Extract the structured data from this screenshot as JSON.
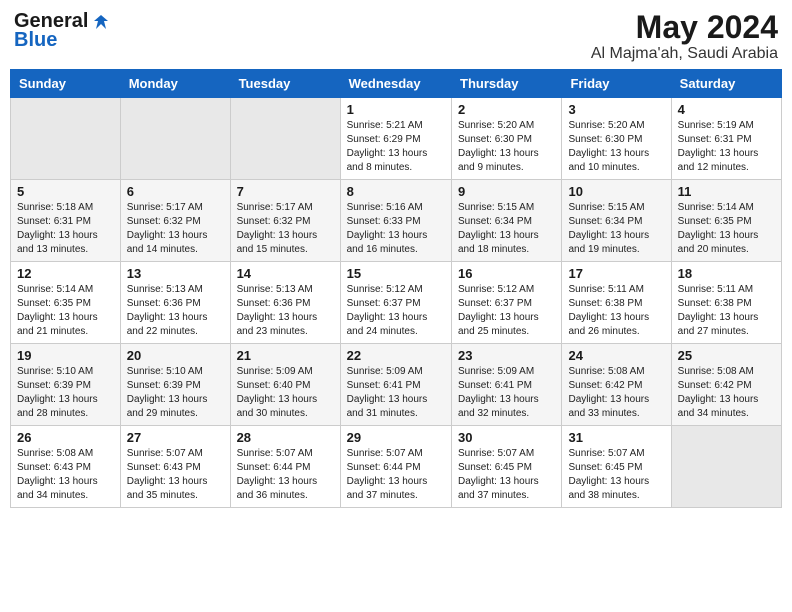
{
  "logo": {
    "line1": "General",
    "line2": "Blue"
  },
  "title": "May 2024",
  "subtitle": "Al Majma'ah, Saudi Arabia",
  "header": {
    "days": [
      "Sunday",
      "Monday",
      "Tuesday",
      "Wednesday",
      "Thursday",
      "Friday",
      "Saturday"
    ]
  },
  "weeks": [
    [
      {
        "day": "",
        "info": ""
      },
      {
        "day": "",
        "info": ""
      },
      {
        "day": "",
        "info": ""
      },
      {
        "day": "1",
        "info": "Sunrise: 5:21 AM\nSunset: 6:29 PM\nDaylight: 13 hours\nand 8 minutes."
      },
      {
        "day": "2",
        "info": "Sunrise: 5:20 AM\nSunset: 6:30 PM\nDaylight: 13 hours\nand 9 minutes."
      },
      {
        "day": "3",
        "info": "Sunrise: 5:20 AM\nSunset: 6:30 PM\nDaylight: 13 hours\nand 10 minutes."
      },
      {
        "day": "4",
        "info": "Sunrise: 5:19 AM\nSunset: 6:31 PM\nDaylight: 13 hours\nand 12 minutes."
      }
    ],
    [
      {
        "day": "5",
        "info": "Sunrise: 5:18 AM\nSunset: 6:31 PM\nDaylight: 13 hours\nand 13 minutes."
      },
      {
        "day": "6",
        "info": "Sunrise: 5:17 AM\nSunset: 6:32 PM\nDaylight: 13 hours\nand 14 minutes."
      },
      {
        "day": "7",
        "info": "Sunrise: 5:17 AM\nSunset: 6:32 PM\nDaylight: 13 hours\nand 15 minutes."
      },
      {
        "day": "8",
        "info": "Sunrise: 5:16 AM\nSunset: 6:33 PM\nDaylight: 13 hours\nand 16 minutes."
      },
      {
        "day": "9",
        "info": "Sunrise: 5:15 AM\nSunset: 6:34 PM\nDaylight: 13 hours\nand 18 minutes."
      },
      {
        "day": "10",
        "info": "Sunrise: 5:15 AM\nSunset: 6:34 PM\nDaylight: 13 hours\nand 19 minutes."
      },
      {
        "day": "11",
        "info": "Sunrise: 5:14 AM\nSunset: 6:35 PM\nDaylight: 13 hours\nand 20 minutes."
      }
    ],
    [
      {
        "day": "12",
        "info": "Sunrise: 5:14 AM\nSunset: 6:35 PM\nDaylight: 13 hours\nand 21 minutes."
      },
      {
        "day": "13",
        "info": "Sunrise: 5:13 AM\nSunset: 6:36 PM\nDaylight: 13 hours\nand 22 minutes."
      },
      {
        "day": "14",
        "info": "Sunrise: 5:13 AM\nSunset: 6:36 PM\nDaylight: 13 hours\nand 23 minutes."
      },
      {
        "day": "15",
        "info": "Sunrise: 5:12 AM\nSunset: 6:37 PM\nDaylight: 13 hours\nand 24 minutes."
      },
      {
        "day": "16",
        "info": "Sunrise: 5:12 AM\nSunset: 6:37 PM\nDaylight: 13 hours\nand 25 minutes."
      },
      {
        "day": "17",
        "info": "Sunrise: 5:11 AM\nSunset: 6:38 PM\nDaylight: 13 hours\nand 26 minutes."
      },
      {
        "day": "18",
        "info": "Sunrise: 5:11 AM\nSunset: 6:38 PM\nDaylight: 13 hours\nand 27 minutes."
      }
    ],
    [
      {
        "day": "19",
        "info": "Sunrise: 5:10 AM\nSunset: 6:39 PM\nDaylight: 13 hours\nand 28 minutes."
      },
      {
        "day": "20",
        "info": "Sunrise: 5:10 AM\nSunset: 6:39 PM\nDaylight: 13 hours\nand 29 minutes."
      },
      {
        "day": "21",
        "info": "Sunrise: 5:09 AM\nSunset: 6:40 PM\nDaylight: 13 hours\nand 30 minutes."
      },
      {
        "day": "22",
        "info": "Sunrise: 5:09 AM\nSunset: 6:41 PM\nDaylight: 13 hours\nand 31 minutes."
      },
      {
        "day": "23",
        "info": "Sunrise: 5:09 AM\nSunset: 6:41 PM\nDaylight: 13 hours\nand 32 minutes."
      },
      {
        "day": "24",
        "info": "Sunrise: 5:08 AM\nSunset: 6:42 PM\nDaylight: 13 hours\nand 33 minutes."
      },
      {
        "day": "25",
        "info": "Sunrise: 5:08 AM\nSunset: 6:42 PM\nDaylight: 13 hours\nand 34 minutes."
      }
    ],
    [
      {
        "day": "26",
        "info": "Sunrise: 5:08 AM\nSunset: 6:43 PM\nDaylight: 13 hours\nand 34 minutes."
      },
      {
        "day": "27",
        "info": "Sunrise: 5:07 AM\nSunset: 6:43 PM\nDaylight: 13 hours\nand 35 minutes."
      },
      {
        "day": "28",
        "info": "Sunrise: 5:07 AM\nSunset: 6:44 PM\nDaylight: 13 hours\nand 36 minutes."
      },
      {
        "day": "29",
        "info": "Sunrise: 5:07 AM\nSunset: 6:44 PM\nDaylight: 13 hours\nand 37 minutes."
      },
      {
        "day": "30",
        "info": "Sunrise: 5:07 AM\nSunset: 6:45 PM\nDaylight: 13 hours\nand 37 minutes."
      },
      {
        "day": "31",
        "info": "Sunrise: 5:07 AM\nSunset: 6:45 PM\nDaylight: 13 hours\nand 38 minutes."
      },
      {
        "day": "",
        "info": ""
      }
    ]
  ]
}
